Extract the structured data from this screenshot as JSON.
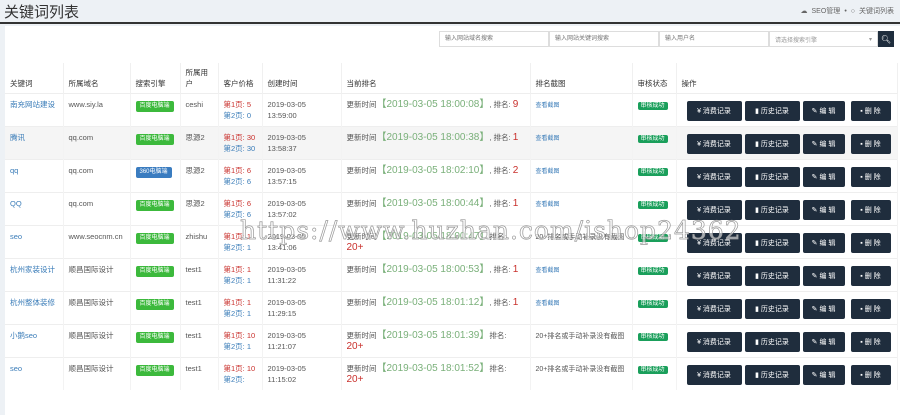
{
  "header": {
    "title": "关键词列表",
    "breadcrumb": [
      "SEO管理",
      "关键词列表"
    ]
  },
  "search": {
    "domain_placeholder": "输入网站域名搜索",
    "keyword_placeholder": "输入网站关键词搜索",
    "user_placeholder": "输入用户名",
    "engine_select": "请选择搜索引擎"
  },
  "columns": [
    "关键词",
    "所属域名",
    "搜索引擎",
    "所属用户",
    "客户价格",
    "创建时间",
    "当前排名",
    "排名截图",
    "审核状态",
    "操作"
  ],
  "labels": {
    "update": "更新时间",
    "rank": "排名:",
    "page1": "第1页:",
    "page2": "第2页:",
    "consume": "¥ 消费记录",
    "history": "历史记录",
    "edit": "编 辑",
    "delete": "删 除"
  },
  "rows": [
    {
      "keyword": "南充网站建设",
      "domain": "www.siy.la",
      "engine": "百度电脑端",
      "engine_color": "#3cb93c",
      "user": "ceshi",
      "p1": "5",
      "p2": "0",
      "created": "2019-03-05 13:59:00",
      "updated": "【2019-03-05 18:00:08】",
      "rank": "9",
      "shot": "查看截图",
      "status": "审核成功"
    },
    {
      "keyword": "腾讯",
      "domain": "qq.com",
      "engine": "百度电脑端",
      "engine_color": "#3cb93c",
      "user": "思源2",
      "p1": "30",
      "p2": "30",
      "created": "2019-03-05 13:58:37",
      "updated": "【2019-03-05 18:00:38】",
      "rank": "1",
      "shot": "查看截图",
      "status": "审核成功"
    },
    {
      "keyword": "qq",
      "domain": "qq.com",
      "engine": "360电脑端",
      "engine_color": "#3a7cc0",
      "user": "思源2",
      "p1": "6",
      "p2": "6",
      "created": "2019-03-05 13:57:15",
      "updated": "【2019-03-05 18:02:10】",
      "rank": "2",
      "shot": "查看截图",
      "status": "审核成功"
    },
    {
      "keyword": "QQ",
      "domain": "qq.com",
      "engine": "百度电脑端",
      "engine_color": "#3cb93c",
      "user": "思源2",
      "p1": "6",
      "p2": "6",
      "created": "2019-03-05 13:57:02",
      "updated": "【2019-03-05 18:00:44】",
      "rank": "1",
      "shot": "查看截图",
      "status": "审核成功"
    },
    {
      "keyword": "seo",
      "domain": "www.seocnm.cn",
      "engine": "百度电脑端",
      "engine_color": "#3cb93c",
      "user": "zhishu",
      "p1": "1",
      "p2": "1",
      "created": "2019-03-05 13:41:06",
      "updated": "【2019-03-05 18:00:47】",
      "rank": "20+",
      "shot": "20+排名或手动补录没有截图",
      "status": "审核成功"
    },
    {
      "keyword": "杭州家装设计",
      "domain": "顺昌国际设计",
      "engine": "百度电脑端",
      "engine_color": "#3cb93c",
      "user": "test1",
      "p1": "1",
      "p2": "1",
      "created": "2019-03-05 11:31:22",
      "updated": "【2019-03-05 18:00:53】",
      "rank": "1",
      "shot": "查看截图",
      "status": "审核成功"
    },
    {
      "keyword": "杭州整体装修",
      "domain": "顺昌国际设计",
      "engine": "百度电脑端",
      "engine_color": "#3cb93c",
      "user": "test1",
      "p1": "1",
      "p2": "1",
      "created": "2019-03-05 11:29:15",
      "updated": "【2019-03-05 18:01:12】",
      "rank": "1",
      "shot": "查看截图",
      "status": "审核成功"
    },
    {
      "keyword": "小鹅seo",
      "domain": "顺昌国际设计",
      "engine": "百度电脑端",
      "engine_color": "#3cb93c",
      "user": "test1",
      "p1": "10",
      "p2": "1",
      "created": "2019-03-05 11:21:07",
      "updated": "【2019-03-05 18:01:39】",
      "rank": "20+",
      "shot": "20+排名或手动补录没有截图",
      "status": "审核成功"
    },
    {
      "keyword": "seo",
      "domain": "顺昌国际设计",
      "engine": "百度电脑端",
      "engine_color": "#3cb93c",
      "user": "test1",
      "p1": "10",
      "p2": "",
      "created": "2019-03-05 11:15:02",
      "updated": "【2019-03-05 18:01:52】",
      "rank": "20+",
      "shot": "20+排名或手动补录没有截图",
      "status": "审核成功"
    }
  ],
  "watermark": "https://www.huzhan.com/ishop24362"
}
